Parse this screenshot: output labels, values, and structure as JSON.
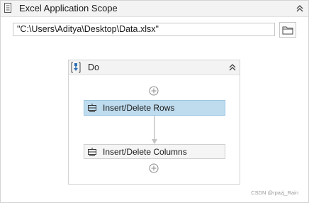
{
  "scope": {
    "title": "Excel Application Scope",
    "icon": "excel-scope-icon",
    "collapse_icon": "double-chevron-up-icon"
  },
  "workbook": {
    "path_value": "\"C:\\Users\\Aditya\\Desktop\\Data.xlsx\"",
    "browse_icon": "folder-icon"
  },
  "do_sequence": {
    "title": "Do",
    "icon": "sequence-icon",
    "collapse_icon": "double-chevron-up-icon",
    "activities": [
      {
        "label": "Insert/Delete Rows",
        "icon": "activity-icon",
        "selected": true
      },
      {
        "label": "Insert/Delete Columns",
        "icon": "activity-icon",
        "selected": false
      }
    ]
  },
  "watermark": "CSDN @rpazj_Rain",
  "colors": {
    "selected_activity": "#bfdcee",
    "activity_bg": "#f5f5f5",
    "header_bg": "#f3f3f3",
    "do_icon_blue": "#2f6fb3"
  }
}
